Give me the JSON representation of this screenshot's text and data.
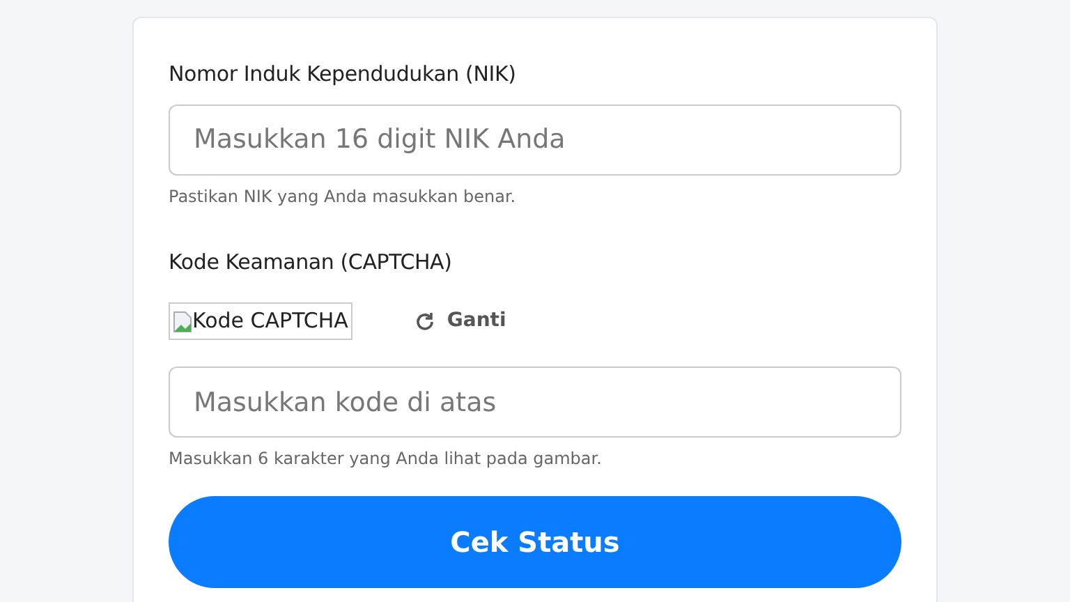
{
  "form": {
    "nik": {
      "label": "Nomor Induk Kependudukan (NIK)",
      "placeholder": "Masukkan 16 digit NIK Anda",
      "help": "Pastikan NIK yang Anda masukkan benar."
    },
    "captcha": {
      "label": "Kode Keamanan (CAPTCHA)",
      "image_alt": "Kode CAPTCHA",
      "refresh": "Ganti",
      "placeholder": "Masukkan kode di atas",
      "help": "Masukkan 6 karakter yang Anda lihat pada gambar."
    },
    "submit": "Cek Status"
  }
}
